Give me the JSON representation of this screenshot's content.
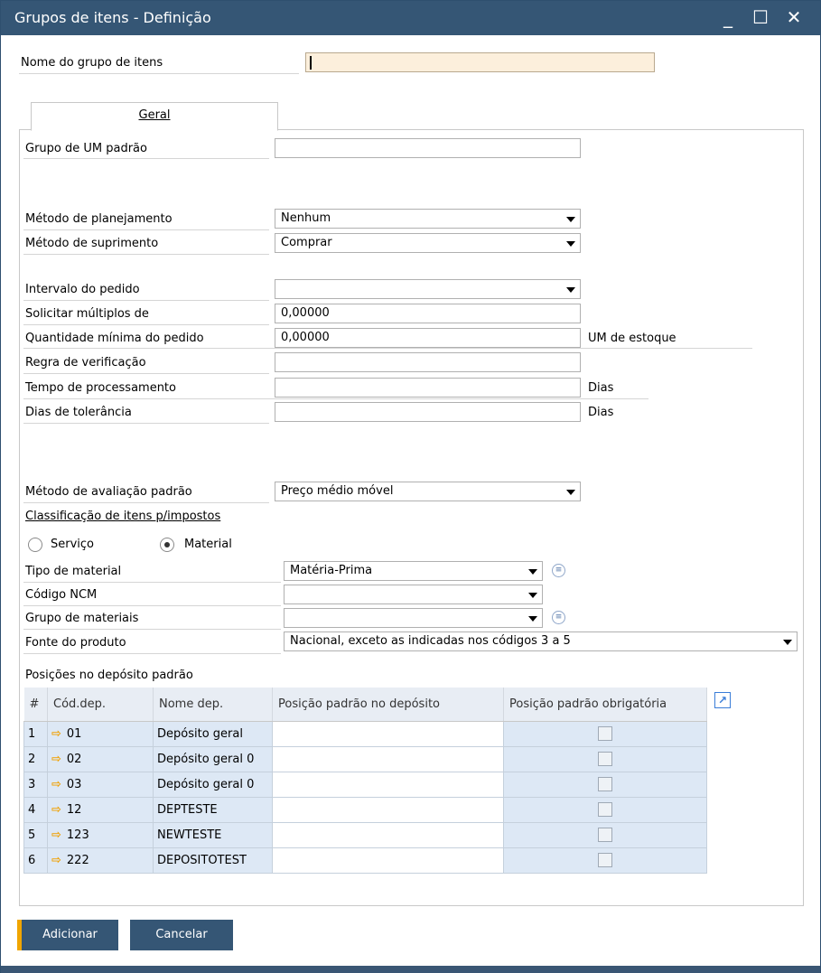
{
  "window": {
    "title": "Grupos de itens - Definição",
    "minimize": "_",
    "maximize": "☐",
    "close": "✕"
  },
  "header": {
    "group_name_label": "Nome do grupo de itens",
    "group_name_value": ""
  },
  "tab": {
    "label": "Geral"
  },
  "fields": {
    "uom_group_label": "Grupo de UM padrão",
    "uom_group_value": "",
    "planning_method_label": "Método de planejamento",
    "planning_method_value": "Nenhum",
    "procurement_method_label": "Método de suprimento",
    "procurement_method_value": "Comprar",
    "order_interval_label": "Intervalo do pedido",
    "order_interval_value": "",
    "order_multiple_label": "Solicitar múltiplos de",
    "order_multiple_value": "0,00000",
    "min_order_qty_label": "Quantidade mínima do pedido",
    "min_order_qty_value": "0,00000",
    "min_order_qty_unit": "UM de estoque",
    "check_rule_label": "Regra de verificação",
    "check_rule_value": "",
    "lead_time_label": "Tempo de processamento",
    "lead_time_value": "",
    "lead_time_unit": "Dias",
    "tolerance_days_label": "Dias de tolerância",
    "tolerance_days_value": "",
    "tolerance_days_unit": "Dias",
    "valuation_method_label": "Método de avaliação padrão",
    "valuation_method_value": "Preço médio móvel",
    "tax_classification_label": "Classificação de itens p/impostos",
    "radio_service_label": "Serviço",
    "radio_material_label": "Material",
    "material_type_label": "Tipo de material",
    "material_type_value": "Matéria-Prima",
    "ncm_code_label": "Código NCM",
    "ncm_code_value": "",
    "material_group_label": "Grupo de materiais",
    "material_group_value": "",
    "product_source_label": "Fonte do produto",
    "product_source_value": "Nacional, exceto as indicadas nos códigos 3 a 5",
    "bin_locations_label": "Posições no depósito padrão"
  },
  "grid": {
    "columns": [
      "#",
      "Cód.dep.",
      "Nome dep.",
      "Posição padrão no depósito",
      "Posição padrão obrigatória"
    ],
    "rows": [
      {
        "num": "1",
        "code": "01",
        "name": "Depósito geral",
        "pos": ""
      },
      {
        "num": "2",
        "code": "02",
        "name": "Depósito geral 0",
        "pos": ""
      },
      {
        "num": "3",
        "code": "03",
        "name": "Depósito geral 0",
        "pos": ""
      },
      {
        "num": "4",
        "code": "12",
        "name": "DEPTESTE",
        "pos": ""
      },
      {
        "num": "5",
        "code": "123",
        "name": "NEWTESTE",
        "pos": ""
      },
      {
        "num": "6",
        "code": "222",
        "name": "DEPOSITOTEST",
        "pos": ""
      }
    ]
  },
  "buttons": {
    "add": "Adicionar",
    "cancel": "Cancelar"
  },
  "colors": {
    "titlebar": "#355675",
    "accent": "#f0a500",
    "focus_field": "#fcefdc",
    "grid_cell": "#dde8f5"
  }
}
